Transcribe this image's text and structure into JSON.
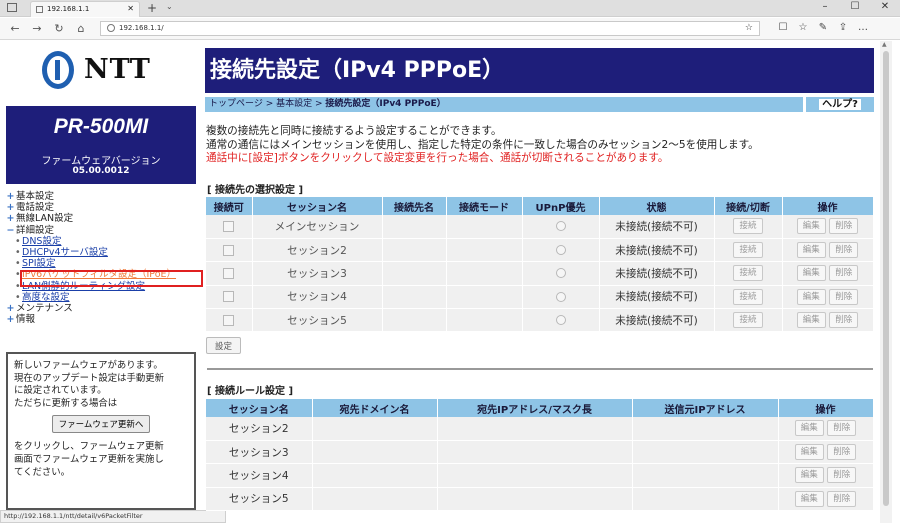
{
  "browser": {
    "tab_title": "192.168.1.1",
    "tab_close": "✕",
    "new_tab": "+",
    "tab_dropdown": "⌄",
    "url": "192.168.1.1/",
    "status_url": "http://192.168.1.1/ntt/detail/v6PacketFilter",
    "nav_icons": [
      "back-icon",
      "forward-icon",
      "refresh-icon",
      "home-icon"
    ],
    "window_icons": [
      "minimize-icon",
      "maximize-icon",
      "close-icon"
    ]
  },
  "sidebar": {
    "logo_text": "NTT",
    "model_name": "PR-500MI",
    "firmware_label": "ファームウェアバージョン",
    "firmware_version": "05.00.0012",
    "menu": [
      {
        "sign": "+",
        "label": "基本設定"
      },
      {
        "sign": "+",
        "label": "電話設定"
      },
      {
        "sign": "+",
        "label": "無線LAN設定"
      },
      {
        "sign": "−",
        "label": "詳細設定"
      }
    ],
    "submenu": [
      {
        "label": "DNS設定"
      },
      {
        "label": "DHCPv4サーバ設定"
      },
      {
        "label": "SPI設定"
      },
      {
        "label": "IPv6パケットフィルタ設定（IPoE）"
      },
      {
        "label": "LAN側静的ルーティング設定"
      },
      {
        "label": "高度な設定"
      }
    ],
    "menu_bottom": [
      {
        "sign": "+",
        "label": "メンテナンス"
      },
      {
        "sign": "+",
        "label": "情報"
      }
    ],
    "notice": {
      "lines_top": [
        "新しいファームウェアがあります。",
        "現在のアップデート設定は手動更新",
        "に設定されています。",
        "ただちに更新する場合は"
      ],
      "button": "ファームウェア更新へ",
      "lines_bottom": [
        "をクリックし、ファームウェア更新",
        "画面でファームウェア更新を実施し",
        "てください。"
      ]
    }
  },
  "main": {
    "title": "接続先設定（IPv4 PPPoE）",
    "breadcrumb": {
      "home": "トップページ",
      "sep": " > ",
      "basic": "基本設定",
      "current": "接続先設定（IPv4 PPPoE）"
    },
    "help": "ヘルプ?",
    "description": [
      "複数の接続先と同時に接続するよう設定することができます。",
      "通常の通信にはメインセッションを使用し、指定した特定の条件に一致した場合のみセッション2〜5を使用します。"
    ],
    "warning": "通話中に[設定]ボタンをクリックして設定変更を行った場合、通話が切断されることがあります。",
    "section1_title": "[ 接続先の選択設定 ]",
    "table1_headers": [
      "接続可",
      "セッション名",
      "接続先名",
      "接続モード",
      "UPnP優先",
      "状態",
      "接続/切断",
      "操作"
    ],
    "table1_rows": [
      {
        "session": "メインセッション",
        "status": "未接続(接続不可)"
      },
      {
        "session": "セッション2",
        "status": "未接続(接続不可)"
      },
      {
        "session": "セッション3",
        "status": "未接続(接続不可)"
      },
      {
        "session": "セッション4",
        "status": "未接続(接続不可)"
      },
      {
        "session": "セッション5",
        "status": "未接続(接続不可)"
      }
    ],
    "connect_btn": "接続",
    "edit_btn": "編集",
    "delete_btn": "削除",
    "set_btn": "設定",
    "section2_title": "[ 接続ルール設定 ]",
    "table2_headers": [
      "セッション名",
      "宛先ドメイン名",
      "宛先IPアドレス/マスク長",
      "送信元IPアドレス",
      "操作"
    ],
    "table2_rows": [
      {
        "session": "セッション2"
      },
      {
        "session": "セッション3"
      },
      {
        "session": "セッション4"
      },
      {
        "session": "セッション5"
      }
    ]
  }
}
